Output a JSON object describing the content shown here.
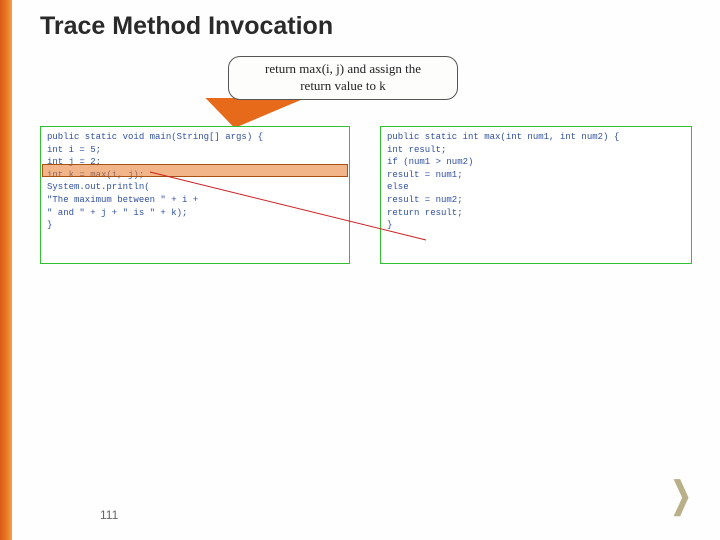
{
  "title": "Trace Method Invocation",
  "callout": {
    "line1": "return max(i, j) and assign the",
    "line2": "return value to k"
  },
  "code_left": {
    "l1": "public static void main(String[] args) {",
    "l2": "  int i = 5;",
    "l3": "  int j = 2;",
    "l4": "  int k = max(i, j);",
    "l5": "",
    "l6": "  System.out.println(",
    "l7": "   \"The maximum between \" + i +",
    "l8": "   \" and \" + j + \" is \" + k);",
    "l9": "}"
  },
  "code_right": {
    "r1": "public static int max(int num1, int num2) {",
    "r2": "  int result;",
    "r3": "",
    "r4": "  if (num1 > num2)",
    "r5": "    result = num1;",
    "r6": "  else",
    "r7": "    result = num2;",
    "r8": "",
    "r9": "  return result;",
    "r10": "}"
  },
  "page_number": "111",
  "chevron": "❯"
}
